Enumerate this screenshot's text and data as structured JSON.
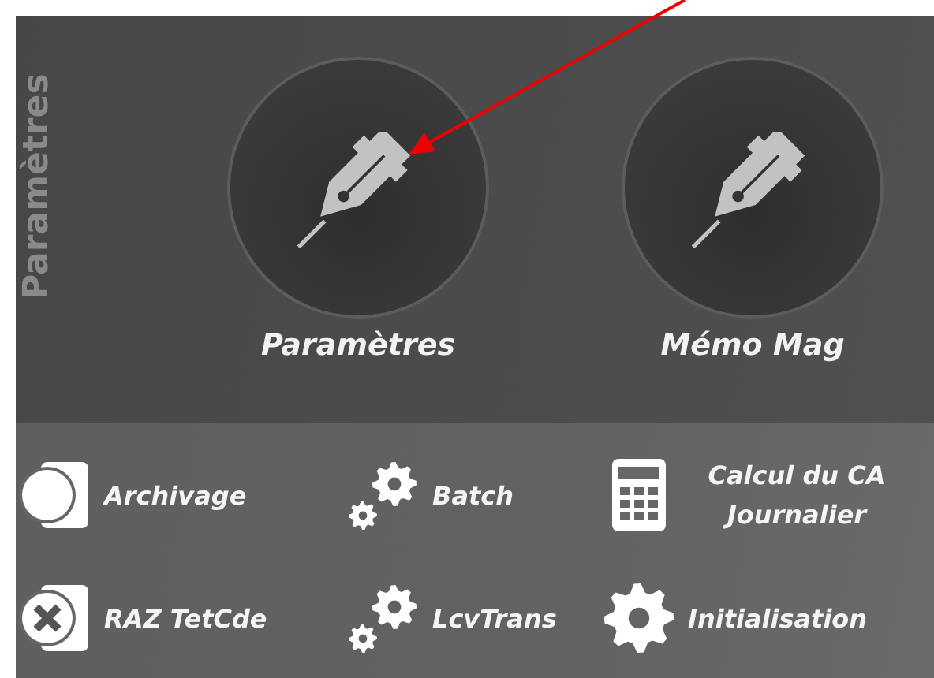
{
  "panel_title": "Paramètres",
  "tiles": [
    {
      "label": "Paramètres"
    },
    {
      "label": "Mémo Mag"
    }
  ],
  "shortcuts": [
    {
      "label": "Archivage",
      "kind": "toggle"
    },
    {
      "label": "Batch",
      "kind": "gears"
    },
    {
      "label": "Calcul du CA Journalier",
      "kind": "calculator"
    },
    {
      "label": "RAZ TetCde",
      "kind": "close"
    },
    {
      "label": "LcvTrans",
      "kind": "gears"
    },
    {
      "label": "Initialisation",
      "kind": "gear"
    }
  ]
}
